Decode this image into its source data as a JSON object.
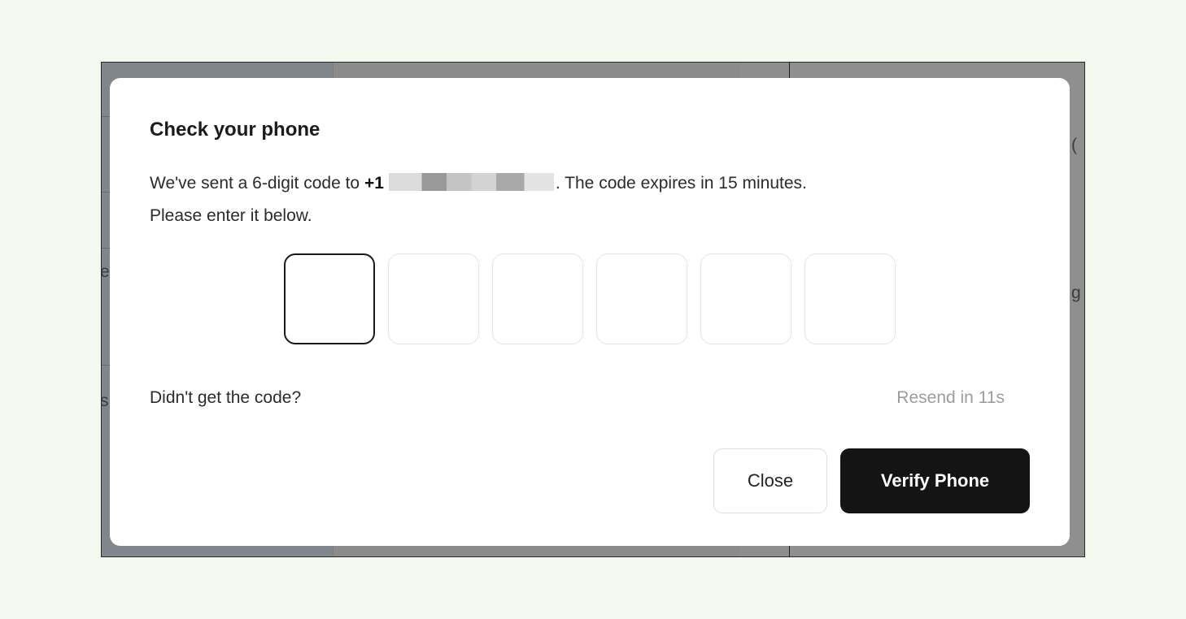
{
  "background": {
    "glyphs": [
      "(",
      "g",
      "e",
      "s"
    ]
  },
  "modal": {
    "title": "Check your phone",
    "description_prefix": "We've sent a 6-digit code to ",
    "phone_prefix": "+1",
    "description_suffix": ". The code expires in 15 minutes.",
    "description_line2": "Please enter it below.",
    "code_length": 6,
    "code_digits": [
      "",
      "",
      "",
      "",
      "",
      ""
    ],
    "active_digit_index": 0,
    "didnt_get_code": "Didn't get the code?",
    "resend_label": "Resend in 11s",
    "close_label": "Close",
    "verify_label": "Verify Phone"
  },
  "colors": {
    "accent": "#141414",
    "muted_text": "#9c9c9c",
    "overlay": "#8e8e8e",
    "page_bg": "#f3f9ef"
  }
}
